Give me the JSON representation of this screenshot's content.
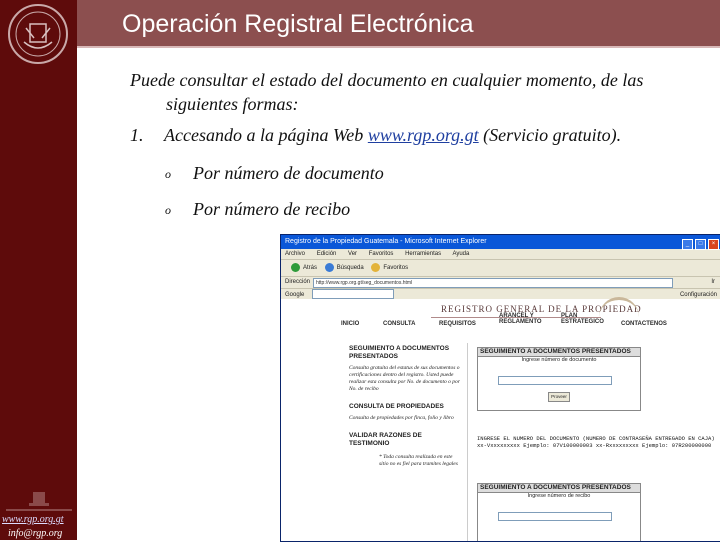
{
  "slide": {
    "title": "Operación Registral Electrónica",
    "intro_line1": "Puede consultar el estado del documento en cualquier momento, de las",
    "intro_line2": "siguientes formas:",
    "item1_number": "1.",
    "item1_text": "Accesando a la página Web ",
    "item1_link": "www.rgp.org.gt",
    "item1_suffix": " (Servicio gratuito).",
    "bullet_symbol": "o",
    "sub_items": [
      "Por número de documento",
      "Por número de recibo"
    ]
  },
  "sidebar": {
    "website": "www.rgp.org.gt",
    "email": "info@rgp.org"
  },
  "browser": {
    "window_title": "Registro de la Propiedad Guatemala - Microsoft Internet Explorer",
    "menu": [
      "Archivo",
      "Edición",
      "Ver",
      "Favoritos",
      "Herramientas",
      "Ayuda"
    ],
    "toolbar": [
      "Atrás",
      "Búsqueda",
      "Favoritos"
    ],
    "address_label": "Dirección",
    "address_value": "http://www.rgp.org.gt/seg_documentos.html",
    "go_label": "Ir",
    "google_label": "Google",
    "google_right": "Configuración",
    "page": {
      "registry_title": "REGISTRO GENERAL DE LA PROPIEDAD",
      "nav": [
        "INICIO",
        "CONSULTA",
        "REQUISITOS",
        "ARANCEL Y REGLAMENTO",
        "PLAN ESTRATEGICO",
        "CONTACTENOS"
      ],
      "left_sections": [
        {
          "heading": "SEGUIMIENTO A DOCUMENTOS PRESENTADOS",
          "text": "Consulta gratuita del estatus de sus documentos o certificaciones dentro del registro. Usted puede realizar esta consulta por No. de documento o por No. de recibo"
        },
        {
          "heading": "CONSULTA DE PROPIEDADES",
          "text": "Consulta de propiedades por finca, folio y libro"
        },
        {
          "heading": "VALIDAR RAZONES DE TESTIMONIO",
          "text": "* Toda consulta realizada en este sitio no es fiel para tramites legales"
        }
      ],
      "box1_title": "SEGUIMIENTO A DOCUMENTOS PRESENTADOS",
      "box1_subtitle": "Ingrese número de documento",
      "box_button": "Proveer",
      "mid_text": "INGRESE EL NUMERO DEL DOCUMENTO (NUMERO DE CONTRASEÑA ENTREGADO EN CAJA) xx-Vxxxxxxxxx Ejemplo: 07V100000003 xx-Rxxxxxxxxx Ejemplo: 07R200000000",
      "box2_title": "SEGUIMIENTO A DOCUMENTOS PRESENTADOS",
      "box2_subtitle": "Ingrese número de recibo"
    }
  }
}
